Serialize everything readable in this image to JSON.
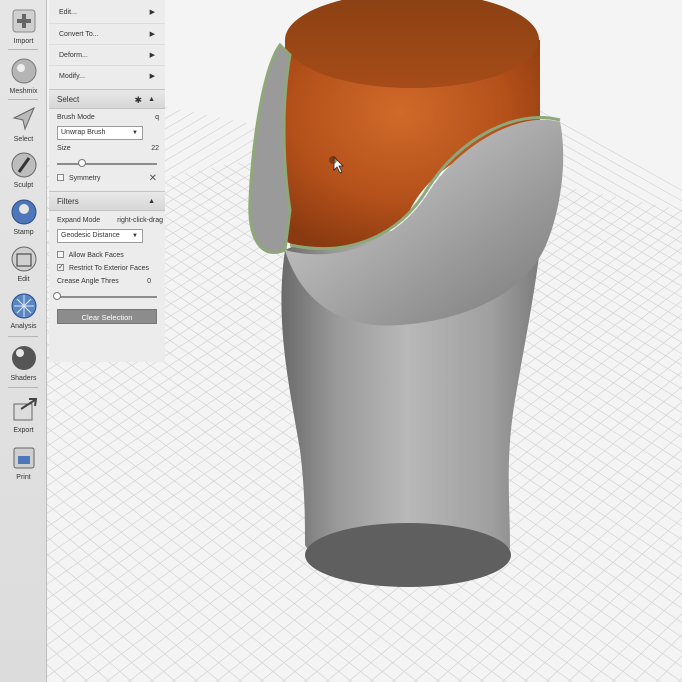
{
  "toolbar": {
    "items": [
      {
        "label": "Import",
        "icon": "plus-icon"
      },
      {
        "label": "Meshmix",
        "icon": "meshmix-icon"
      },
      {
        "label": "Select",
        "icon": "select-arrow-icon"
      },
      {
        "label": "Sculpt",
        "icon": "brush-icon"
      },
      {
        "label": "Stamp",
        "icon": "stamp-icon"
      },
      {
        "label": "Edit",
        "icon": "edit-icon"
      },
      {
        "label": "Analysis",
        "icon": "analysis-icon"
      },
      {
        "label": "Shaders",
        "icon": "sphere-icon"
      },
      {
        "label": "Export",
        "icon": "export-icon"
      },
      {
        "label": "Print",
        "icon": "printer-icon"
      }
    ]
  },
  "menu": {
    "items": [
      {
        "label": "Edit..."
      },
      {
        "label": "Convert To..."
      },
      {
        "label": "Deform..."
      },
      {
        "label": "Modify..."
      }
    ]
  },
  "select_panel": {
    "title": "Select",
    "brush_mode_label": "Brush Mode",
    "brush_mode_shortcut": "q",
    "brush_mode_value": "Unwrap Brush",
    "size_label": "Size",
    "size_value": "22",
    "size_fraction": 0.25,
    "symmetry_label": "Symmetry",
    "symmetry_checked": false
  },
  "filters_panel": {
    "title": "Filters",
    "expand_mode_label": "Expand Mode",
    "expand_mode_hint": "right-click-drag",
    "expand_mode_value": "Geodesic Distance",
    "allow_back_faces_label": "Allow Back Faces",
    "allow_back_faces_checked": false,
    "restrict_exterior_label": "Restrict To Exterior Faces",
    "restrict_exterior_checked": true,
    "crease_label": "Crease Angle Thres",
    "crease_value": "0",
    "crease_fraction": 0.0,
    "clear_button": "Clear Selection"
  },
  "colors": {
    "background": "#f4f4f4",
    "grid": "#c8c8c8",
    "model_gray": "#8a8a8a",
    "cylinder_orange": "#b8501a",
    "rim_green": "#8fa87a"
  }
}
